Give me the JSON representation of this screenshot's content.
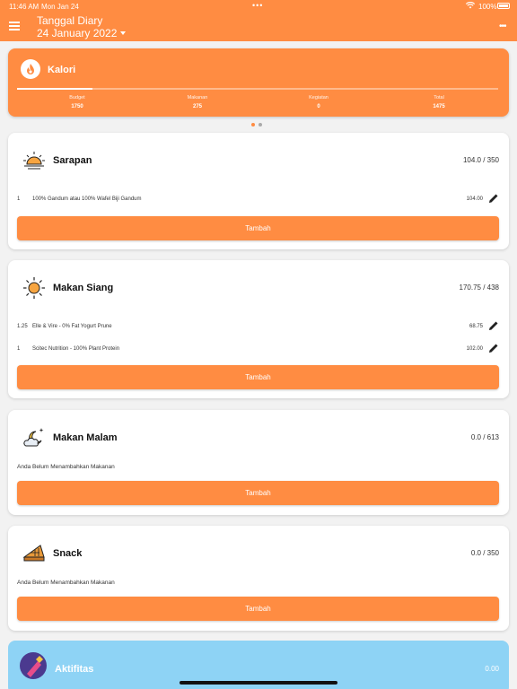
{
  "status_bar": {
    "time": "11:46 AM",
    "date": "Mon Jan 24",
    "battery": "100%"
  },
  "app_bar": {
    "title": "Tanggal Diary",
    "date": "24 January 2022"
  },
  "calorie_card": {
    "title": "Kalori",
    "progress": 0.157,
    "stats": [
      {
        "label": "Budget",
        "value": "1750"
      },
      {
        "label": "Makanan",
        "value": "275"
      },
      {
        "label": "Kegiatan",
        "value": "0"
      },
      {
        "label": "Total",
        "value": "1475"
      }
    ]
  },
  "meals": {
    "breakfast": {
      "name": "Sarapan",
      "total": "104.0 / 350",
      "items": [
        {
          "qty": "1",
          "food": "100% Gandum atau 100% Wafel Biji Gandum",
          "kcal": "104.00"
        }
      ],
      "button": "Tambah"
    },
    "lunch": {
      "name": "Makan Siang",
      "total": "170.75 / 438",
      "items": [
        {
          "qty": "1.25",
          "food": "Elle & Vire - 0% Fat Yogurt Prune",
          "kcal": "68.75"
        },
        {
          "qty": "1",
          "food": "Scitec Nutrition - 100% Plant Protein",
          "kcal": "102.00"
        }
      ],
      "button": "Tambah"
    },
    "dinner": {
      "name": "Makan Malam",
      "total": "0.0 / 613",
      "empty": "Anda Belum Menambahkan Makanan",
      "button": "Tambah"
    },
    "snack": {
      "name": "Snack",
      "total": "0.0 / 350",
      "empty": "Anda Belum Menambahkan Makanan",
      "button": "Tambah"
    }
  },
  "activity": {
    "name": "Aktifitas",
    "total": "0.00"
  },
  "colors": {
    "accent": "#ff8c42",
    "activity": "#8ed3f5"
  }
}
